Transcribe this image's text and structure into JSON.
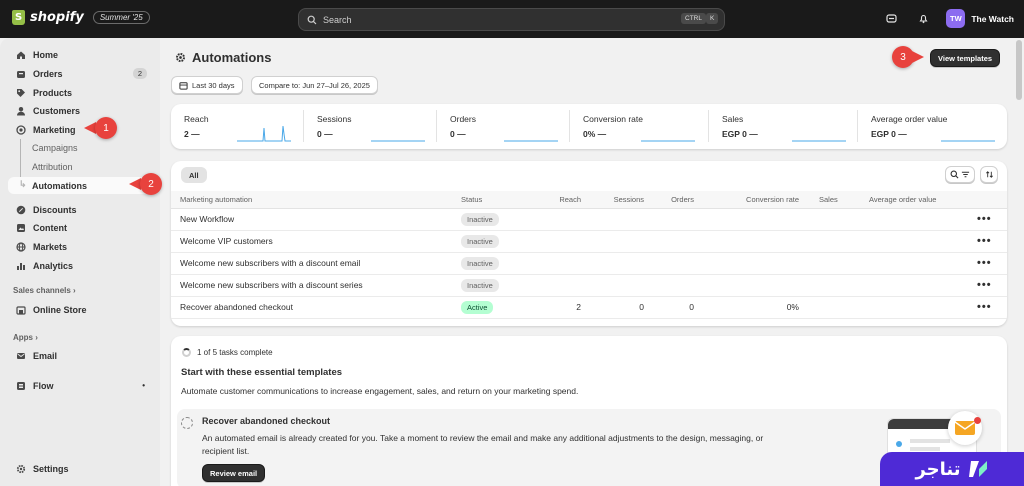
{
  "app": {
    "logo_text": "shopify",
    "edition": "Summer '25",
    "search_placeholder": "Search",
    "search_kbd_1": "CTRL",
    "search_kbd_2": "K",
    "avatar_initials": "TW",
    "store_name": "The Watch"
  },
  "sidebar": {
    "home": "Home",
    "orders": "Orders",
    "orders_count": "2",
    "products": "Products",
    "customers": "Customers",
    "marketing": "Marketing",
    "campaigns": "Campaigns",
    "attribution": "Attribution",
    "automations": "Automations",
    "discounts": "Discounts",
    "content": "Content",
    "markets": "Markets",
    "analytics": "Analytics",
    "sales_channels": "Sales channels",
    "online_store": "Online Store",
    "apps": "Apps",
    "email": "Email",
    "flow": "Flow",
    "settings": "Settings"
  },
  "page": {
    "title": "Automations",
    "view_templates": "View templates",
    "date_range": "Last 30 days",
    "compare": "Compare to: Jun 27–Jul 26, 2025"
  },
  "metrics": [
    {
      "label": "Reach",
      "value": "2 —"
    },
    {
      "label": "Sessions",
      "value": "0 —"
    },
    {
      "label": "Orders",
      "value": "0 —"
    },
    {
      "label": "Conversion rate",
      "value": "0% —"
    },
    {
      "label": "Sales",
      "value": "EGP 0 —"
    },
    {
      "label": "Average order value",
      "value": "EGP 0 —"
    }
  ],
  "table": {
    "tab_all": "All",
    "headers": [
      "Marketing automation",
      "Status",
      "Reach",
      "Sessions",
      "Orders",
      "Conversion rate",
      "Sales",
      "Average order value"
    ],
    "rows": [
      {
        "name": "New Workflow",
        "status": "Inactive",
        "reach": "",
        "sessions": "",
        "orders": "",
        "conversion": ""
      },
      {
        "name": "Welcome VIP customers",
        "status": "Inactive",
        "reach": "",
        "sessions": "",
        "orders": "",
        "conversion": ""
      },
      {
        "name": "Welcome new subscribers with a discount email",
        "status": "Inactive",
        "reach": "",
        "sessions": "",
        "orders": "",
        "conversion": ""
      },
      {
        "name": "Welcome new subscribers with a discount series",
        "status": "Inactive",
        "reach": "",
        "sessions": "",
        "orders": "",
        "conversion": ""
      },
      {
        "name": "Recover abandoned checkout",
        "status": "Active",
        "reach": "2",
        "sessions": "0",
        "orders": "0",
        "conversion": "0%"
      }
    ],
    "more": "•••"
  },
  "setup": {
    "progress": "1 of 5 tasks complete",
    "heading": "Start with these essential templates",
    "description": "Automate customer communications to increase engagement, sales, and return on your marketing spend.",
    "task_title": "Recover abandoned checkout",
    "task_desc_1": "An automated email is already created for you. Take a moment to review the email and make any additional adjustments to the design, messaging, or",
    "task_desc_2": "recipient list.",
    "review_button": "Review email"
  },
  "annotations": {
    "c1": "1",
    "c2": "2",
    "c3": "3"
  },
  "brand": {
    "text": "تناجر"
  },
  "colors": {
    "accent_callout": "#e8423d",
    "active_badge": "#b4fed2",
    "brand_purple": "#4e2ad6",
    "sparkline": "#4aa8e8"
  }
}
